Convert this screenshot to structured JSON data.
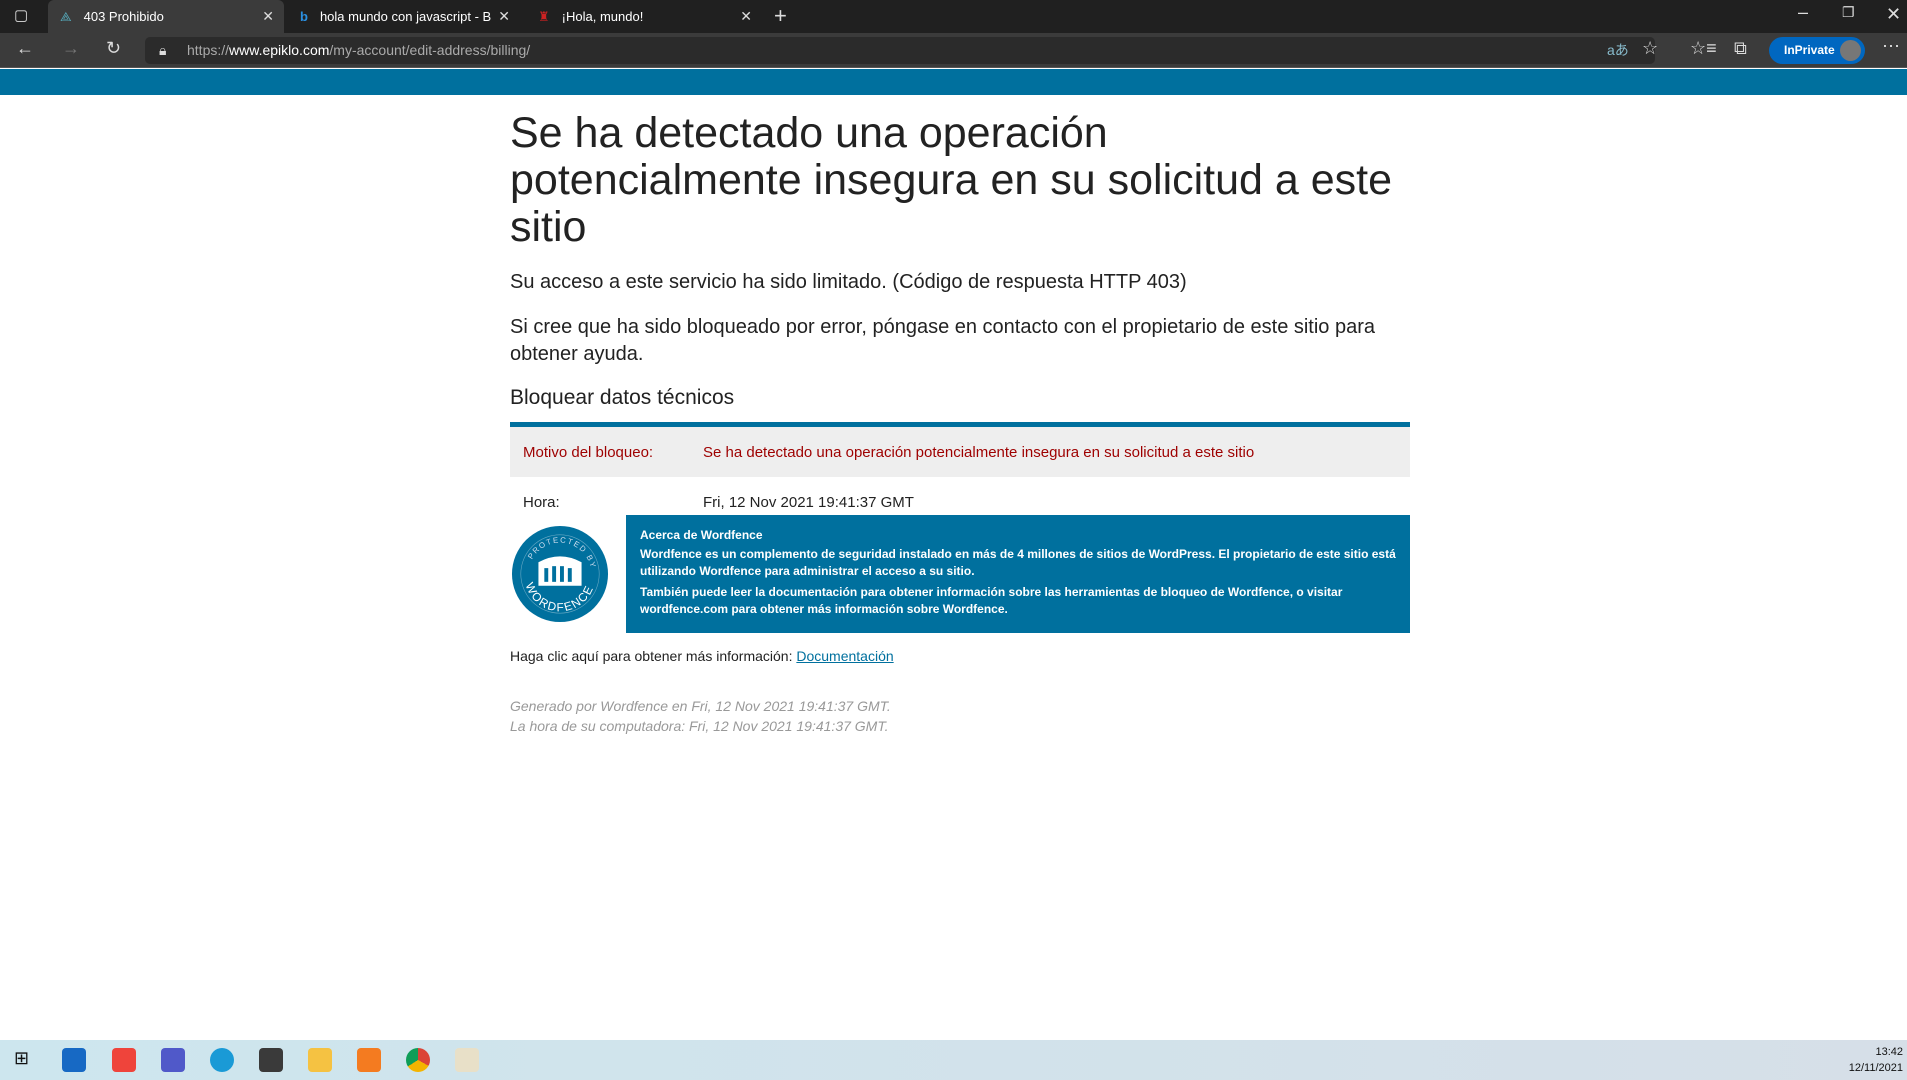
{
  "browser": {
    "tabs": [
      {
        "title": "403 Prohibido",
        "active": true
      },
      {
        "title": "hola mundo con javascript - Bing"
      },
      {
        "title": "¡Hola, mundo!"
      }
    ],
    "url_prefix": "https://",
    "url_domain": "www.epiklo.com",
    "url_path": "/my-account/edit-address/billing/",
    "inprivate": "InPrivate"
  },
  "page": {
    "title": "Se ha detectado una operación potencialmente insegura en su solicitud a este sitio",
    "p1": "Su acceso a este servicio ha sido limitado. (Código de respuesta HTTP 403)",
    "p2": "Si cree que ha sido bloqueado por error, póngase en contacto con el propietario de este sitio para obtener ayuda.",
    "tech_heading": "Bloquear datos técnicos",
    "rows": [
      {
        "label": "Motivo del bloqueo:",
        "value": "Se ha detectado una operación potencialmente insegura en su solicitud a este sitio"
      },
      {
        "label": "Hora:",
        "value": "Fri, 12 Nov 2021 19:41:37 GMT"
      }
    ],
    "about_title": "Acerca de Wordfence",
    "about_p1": "Wordfence es un complemento de seguridad instalado en más de 4 millones de sitios de WordPress. El propietario de este sitio está utilizando Wordfence para administrar el acceso a su sitio.",
    "about_p2": "También puede leer la documentación para obtener información sobre las herramientas de bloqueo de Wordfence, o visitar wordfence.com para obtener más información sobre Wordfence.",
    "logo_text": "PROTECTED BY WORDFENCE",
    "doc_text": "Haga clic aquí para obtener más información:",
    "doc_link": "Documentación",
    "footer1": "Generado por Wordfence en Fri, 12 Nov 2021 19:41:37 GMT.",
    "footer2": "La hora de su computadora: Fri, 12 Nov 2021 19:41:37 GMT."
  },
  "taskbar": {
    "time": "13:42",
    "date": "12/11/2021"
  },
  "colors": {
    "brand": "#00709e",
    "error": "#9e0000"
  }
}
